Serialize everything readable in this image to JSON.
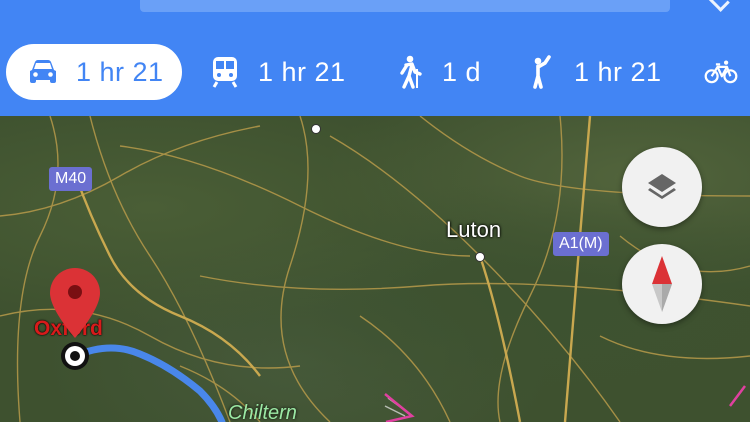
{
  "transport_modes": [
    {
      "mode": "drive",
      "icon": "car-icon",
      "label": "1 hr 21",
      "active": true
    },
    {
      "mode": "transit",
      "icon": "train-icon",
      "label": "1 hr 21",
      "active": false
    },
    {
      "mode": "walk",
      "icon": "walking-icon",
      "label": "1 d",
      "active": false
    },
    {
      "mode": "ride-hailing",
      "icon": "hailing-icon",
      "label": "1 hr 21",
      "active": false
    },
    {
      "mode": "cycle",
      "icon": "bicycle-icon",
      "label": "",
      "active": false
    }
  ],
  "map": {
    "road_labels": [
      "M40",
      "A1(M)"
    ],
    "city_labels": [
      "Luton"
    ],
    "origin_label": "Oxford",
    "area_label": "Chiltern"
  },
  "colors": {
    "header": "#4285f4",
    "route": "#4a8af4",
    "pin": "#db3236"
  }
}
